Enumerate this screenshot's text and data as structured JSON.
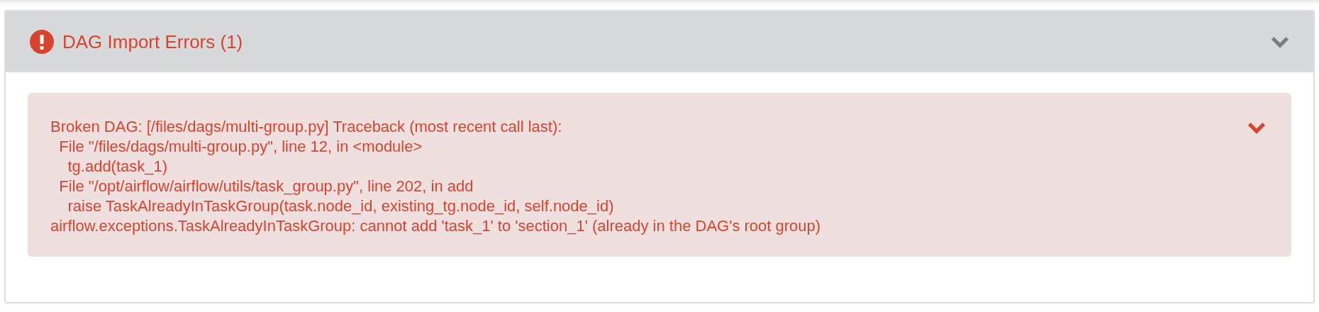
{
  "panel": {
    "title": "DAG Import Errors (1)",
    "errors": [
      {
        "lines": [
          "Broken DAG: [/files/dags/multi-group.py] Traceback (most recent call last):",
          "  File \"/files/dags/multi-group.py\", line 12, in <module>",
          "    tg.add(task_1)",
          "  File \"/opt/airflow/airflow/utils/task_group.py\", line 202, in add",
          "    raise TaskAlreadyInTaskGroup(task.node_id, existing_tg.node_id, self.node_id)",
          "airflow.exceptions.TaskAlreadyInTaskGroup: cannot add 'task_1' to 'section_1' (already in the DAG's root group)"
        ]
      }
    ]
  }
}
